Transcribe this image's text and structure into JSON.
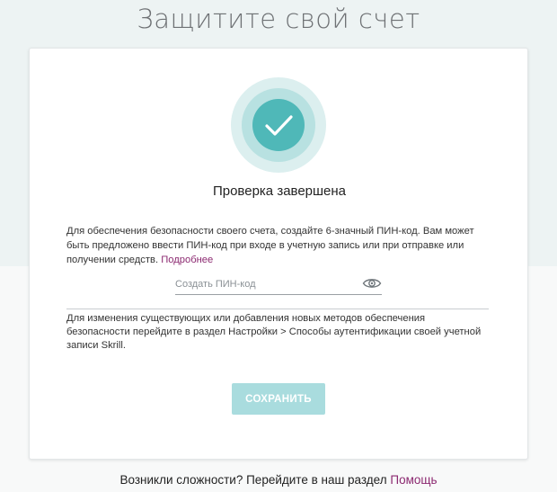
{
  "page": {
    "title": "Защитите свой счет"
  },
  "card": {
    "heading": "Проверка завершена",
    "info_text": "Для обеспечения безопасности своего счета, создайте 6-значный ПИН-код. Вам может быть предложено ввести ПИН-код при входе в учетную запись или при отправке или получении средств. ",
    "info_link": "Подробнее",
    "pin_placeholder": "Создать ПИН-код",
    "pin_value": "",
    "note_text": "Для изменения существующих или добавления новых методов обеспечения безопасности перейдите в раздел Настройки > Способы аутентификации своей учетной записи Skrill.",
    "save_label": "СОХРАНИТЬ"
  },
  "footer": {
    "help_text": "Возникли сложности? Перейдите в наш раздел ",
    "help_link": "Помощь"
  },
  "icons": {
    "success": "check-circle-icon",
    "reveal": "eye-icon"
  },
  "colors": {
    "accent": "#4fb8b8",
    "button_disabled": "#a9dcde",
    "link": "#8c2a71",
    "ring_outer": "#dcefef",
    "ring_middle": "#b8e1e1"
  }
}
